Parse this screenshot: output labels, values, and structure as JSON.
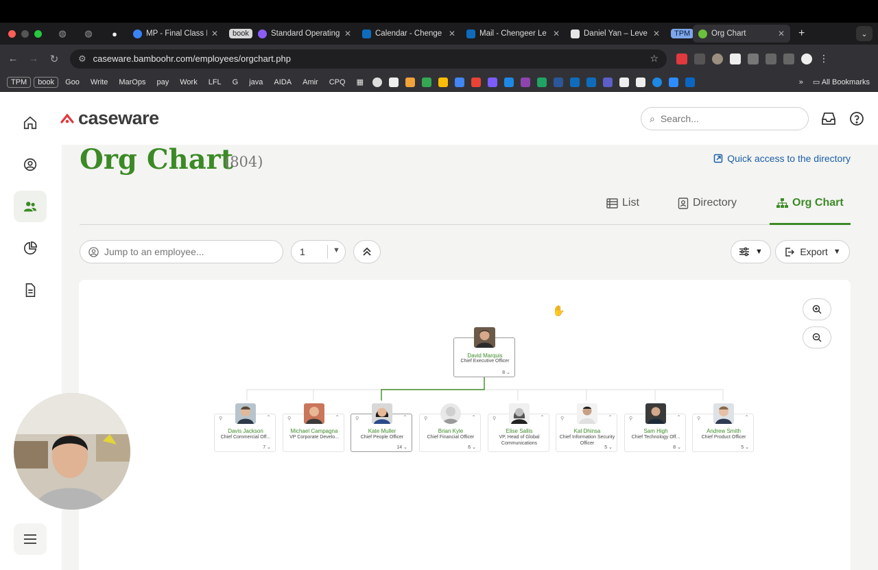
{
  "browser": {
    "tabs": [
      {
        "label": "MP - Final Class Pr",
        "color": "#3b82f6"
      },
      {
        "label": "book",
        "chip": true
      },
      {
        "label": "Standard Operating",
        "color": "#8b5cf6"
      },
      {
        "label": "Calendar - Chenge",
        "color": "#0f6cbd"
      },
      {
        "label": "Mail - Chengeer Le",
        "color": "#0f6cbd"
      },
      {
        "label": "Daniel Yan – Leve",
        "color": "#e5e5e5"
      },
      {
        "label": "TPM",
        "chip": true
      },
      {
        "label": "Org Chart",
        "color": "#6cbf3a",
        "active": true
      }
    ],
    "url": "caseware.bamboohr.com/employees/orgchart.php",
    "bookmarks": [
      "TPM",
      "book",
      "Goo",
      "Write",
      "MarOps",
      "pay",
      "Work",
      "LFL",
      "G",
      "java",
      "AIDA",
      "Amir",
      "CPQ"
    ],
    "all_bookmarks": "All Bookmarks"
  },
  "app": {
    "logo_text": "caseware",
    "search_placeholder": "Search...",
    "page_title": "Org Chart",
    "employee_count": "(804)",
    "quick_access": "Quick access to the directory",
    "tabs": {
      "list": "List",
      "directory": "Directory",
      "org_chart": "Org Chart"
    },
    "jump_placeholder": "Jump to an employee...",
    "level_value": "1",
    "export_label": "Export"
  },
  "org": {
    "ceo": {
      "name": "David Marquis",
      "title": "Chief Executive Officer",
      "count": "8"
    },
    "reports": [
      {
        "name": "Davis Jackson",
        "title": "Chief Commercial Off...",
        "count": "7"
      },
      {
        "name": "Michael Campagna",
        "title": "VP Corporate Develo...",
        "count": ""
      },
      {
        "name": "Kate Muller",
        "title": "Chief People Officer",
        "count": "14"
      },
      {
        "name": "Brian Kyle",
        "title": "Chief Financial Officer",
        "count": "6"
      },
      {
        "name": "Elise Sallis",
        "title": "VP, Head of Global Communications",
        "count": ""
      },
      {
        "name": "Kal Dhinsa",
        "title": "Chief Information Security Officer",
        "count": "5"
      },
      {
        "name": "Sam High",
        "title": "Chief Technology Off...",
        "count": "8"
      },
      {
        "name": "Andrew Smith",
        "title": "Chief Product Officer",
        "count": "5"
      }
    ]
  },
  "colors": {
    "brand_green": "#3b8a25",
    "link_blue": "#1a5ea8",
    "logo_red": "#e0393e"
  }
}
